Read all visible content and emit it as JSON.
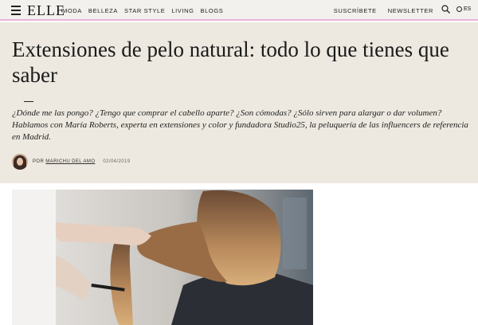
{
  "header": {
    "logo": "ELLE",
    "nav": [
      "MODA",
      "BELLEZA",
      "STAR STYLE",
      "LIVING",
      "BLOGS"
    ],
    "subscribe": "SUSCRÍBETE",
    "newsletter": "NEWSLETTER",
    "language": "ES",
    "accent_color": "#e9b3d8"
  },
  "article": {
    "title": "Extensiones de pelo natural: todo lo que tienes que saber",
    "lede": "¿Dónde me las pongo? ¿Tengo que comprar el cabello aparte? ¿Son cómodas? ¿Sólo sirven para alargar o dar volumen? Hablamos con María Roberts, experta en extensiones y color y fundadora Studio25, la peluquería de las influencers de referencia en Madrid.",
    "byline_prefix": "POR",
    "author": "MARICHU DEL AMO",
    "date": "02/04/2019",
    "hero_bg": "#ede9e0"
  },
  "icons": {
    "menu": "hamburger-icon",
    "search": "search-icon",
    "language": "globe-icon"
  }
}
